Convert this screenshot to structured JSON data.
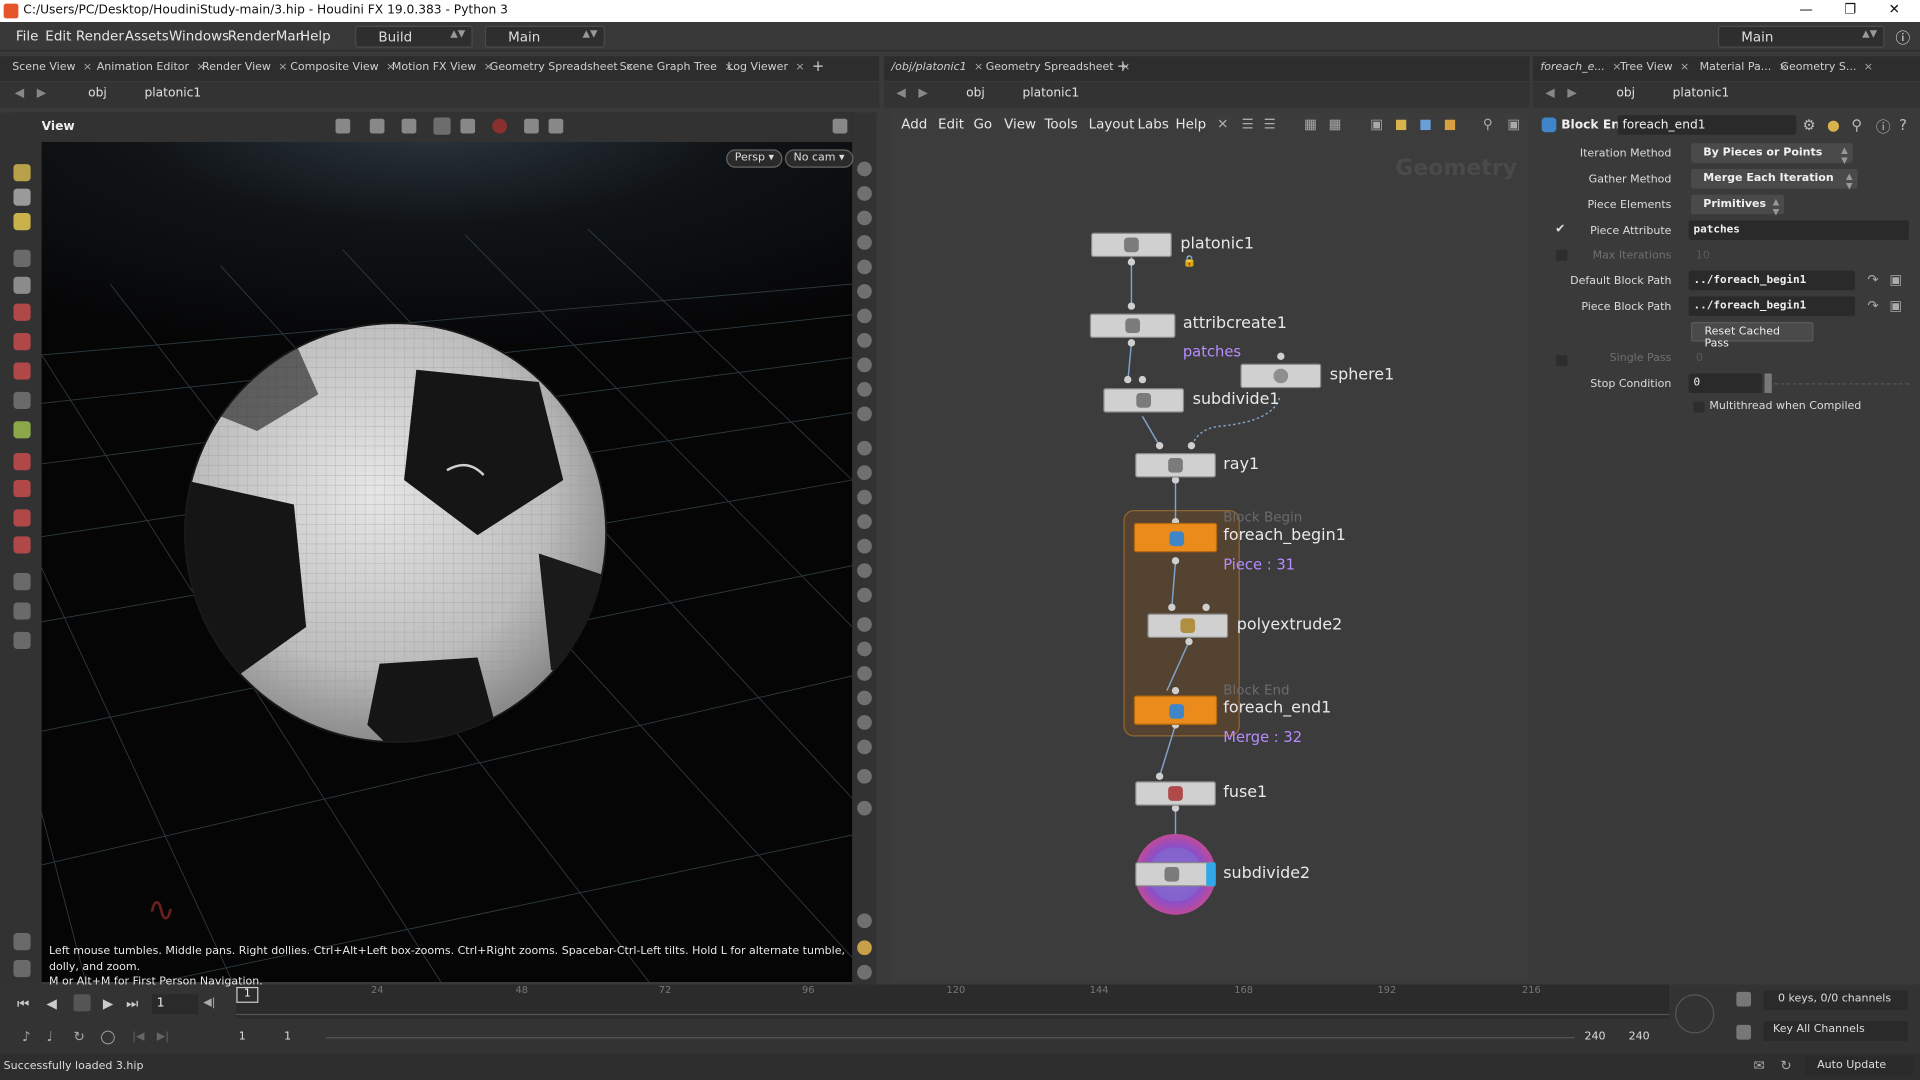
{
  "window": {
    "title": "C:/Users/PC/Desktop/HoudiniStudy-main/3.hip - Houdini FX 19.0.383 - Python 3"
  },
  "menu": [
    "File",
    "Edit",
    "Render",
    "Assets",
    "Windows",
    "RenderMan",
    "Help"
  ],
  "desktop": {
    "build": "Build",
    "main": "Main",
    "right_main": "Main"
  },
  "left_tabs": [
    "Scene View",
    "Animation Editor",
    "Render View",
    "Composite View",
    "Motion FX View",
    "Geometry Spreadsheet",
    "Scene Graph Tree",
    "Log Viewer"
  ],
  "mid_tabs": [
    "/obj/platonic1",
    "Geometry Spreadsheet"
  ],
  "right_tabs": [
    "foreach_e...",
    "Tree View",
    "Material Pa...",
    "Geometry S..."
  ],
  "path": {
    "obj": "obj",
    "node": "platonic1"
  },
  "viewport": {
    "label": "View",
    "persp": "Persp",
    "cam": "No cam",
    "hint_line1": "Left mouse tumbles. Middle pans. Right dollies. Ctrl+Alt+Left box-zooms. Ctrl+Right zooms. Spacebar-Ctrl-Left tilts. Hold L for alternate tumble, dolly, and zoom.",
    "hint_line2": "M or Alt+M for First Person Navigation."
  },
  "network": {
    "menu": [
      "Add",
      "Edit",
      "Go",
      "View",
      "Tools",
      "Layout",
      "Labs",
      "Help"
    ],
    "context": "Geometry",
    "nodes": {
      "platonic1": "platonic1",
      "attribcreate1": "attribcreate1",
      "attribcreate1_sub": "patches",
      "sphere1": "sphere1",
      "subdivide1": "subdivide1",
      "ray1": "ray1",
      "block_begin_type": "Block Begin",
      "foreach_begin1": "foreach_begin1",
      "foreach_begin1_sub": "Piece : 31",
      "polyextrude2": "polyextrude2",
      "block_end_type": "Block End",
      "foreach_end1": "foreach_end1",
      "foreach_end1_sub": "Merge : 32",
      "fuse1": "fuse1",
      "subdivide2": "subdivide2"
    }
  },
  "params": {
    "node_type": "Block End",
    "node_name": "foreach_end1",
    "iteration_method_label": "Iteration Method",
    "iteration_method": "By Pieces or Points",
    "gather_method_label": "Gather Method",
    "gather_method": "Merge Each Iteration",
    "piece_elements_label": "Piece Elements",
    "piece_elements": "Primitives",
    "piece_attribute_label": "Piece Attribute",
    "piece_attribute": "patches",
    "max_iterations_label": "Max Iterations",
    "max_iterations": "10",
    "default_block_path_label": "Default Block Path",
    "default_block_path": "../foreach_begin1",
    "piece_block_path_label": "Piece Block Path",
    "piece_block_path": "../foreach_begin1",
    "reset_cached_pass": "Reset Cached Pass",
    "single_pass_label": "Single Pass",
    "single_pass": "0",
    "stop_condition_label": "Stop Condition",
    "stop_condition": "0",
    "multithread_label": "Multithread when Compiled"
  },
  "timeline": {
    "frame": "1",
    "ticks": [
      "24",
      "48",
      "72",
      "96",
      "120",
      "144",
      "168",
      "192",
      "216"
    ],
    "start": "1",
    "start2": "1",
    "end": "240",
    "end2": "240",
    "current_marker": "1",
    "keys_info": "0 keys, 0/0 channels",
    "key_all": "Key All Channels"
  },
  "status": {
    "message": "Successfully loaded 3.hip",
    "auto_update": "Auto Update"
  }
}
